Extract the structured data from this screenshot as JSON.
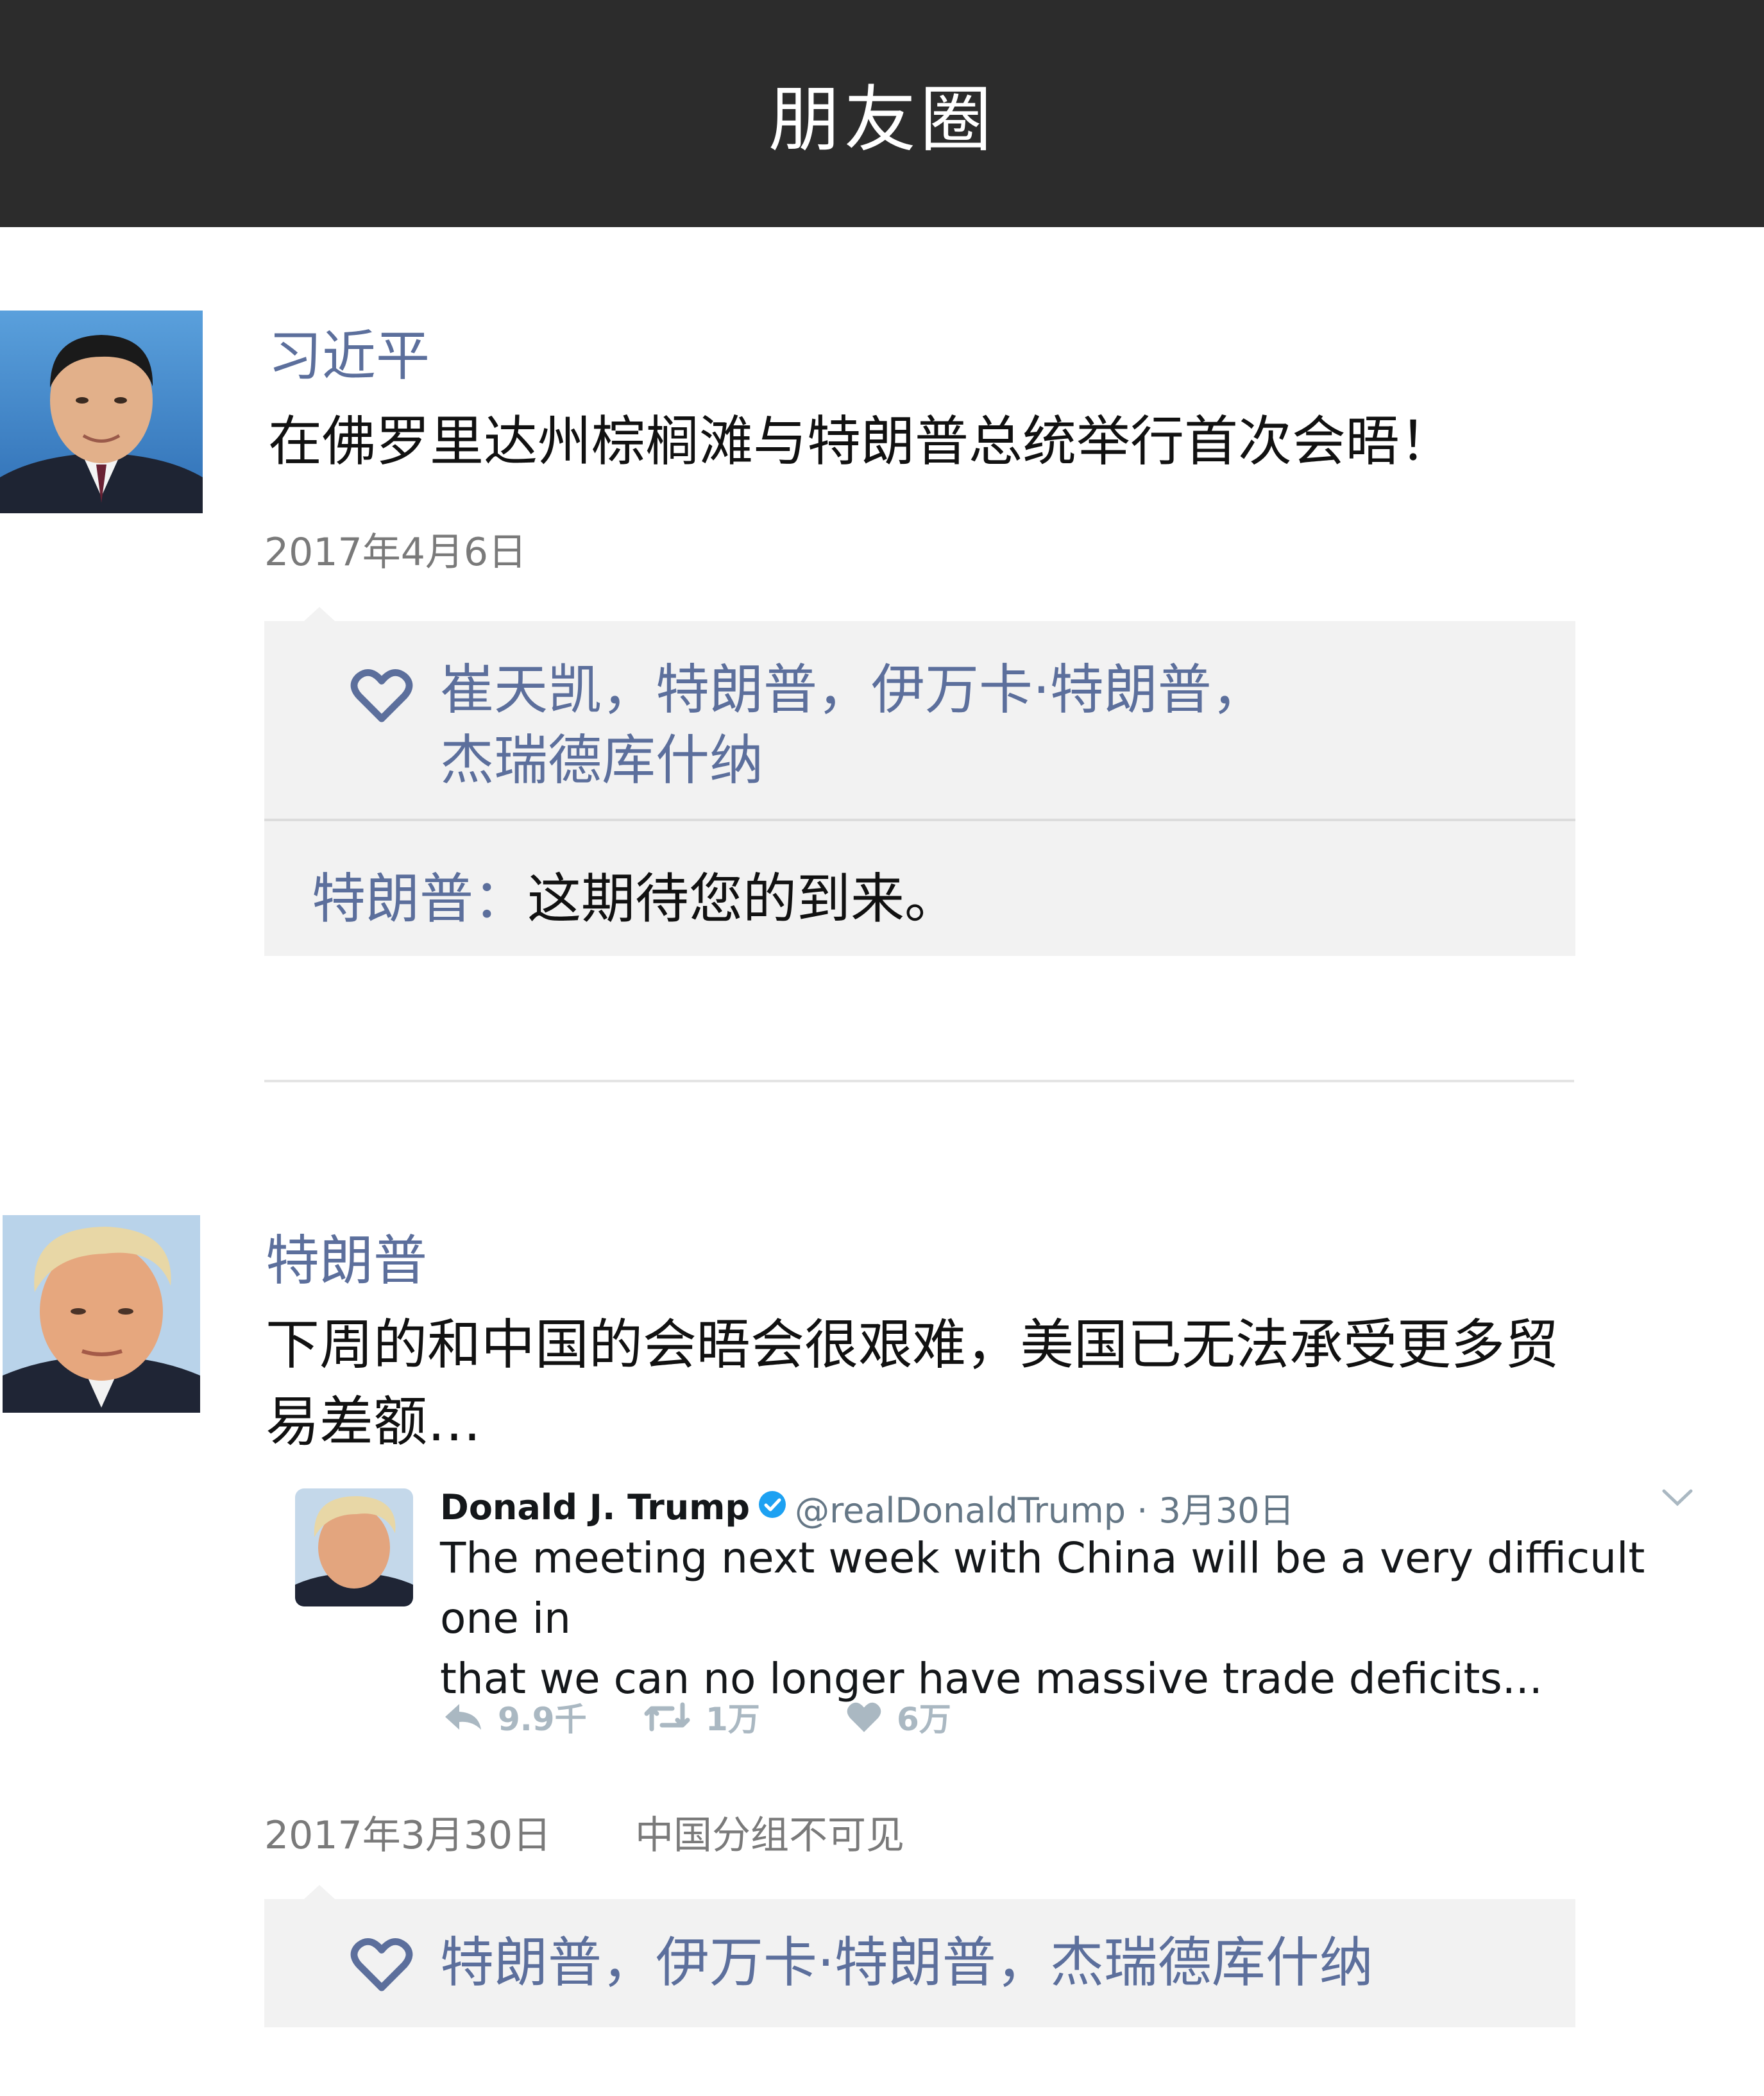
{
  "header": {
    "title": "朋友圈"
  },
  "posts": [
    {
      "author": "习近平",
      "text": "在佛罗里达州棕榈滩与特朗普总统举行首次会晤！",
      "date": "2017年4月6日",
      "likes_line1": "崔天凯，特朗普，伊万卡·特朗普，",
      "likes_line2": "杰瑞德库什纳",
      "comment": {
        "author": "特朗普：",
        "text": "这期待您的到来。"
      }
    },
    {
      "author": "特朗普",
      "text_line1": "下周的和中国的会晤会很艰难，美国已无法承受更多贸",
      "text_line2": "易差额…",
      "date": "2017年3月30日",
      "visibility": "中国分组不可见",
      "likes": "特朗普，伊万卡·特朗普，杰瑞德库什纳",
      "tweet": {
        "name": "Donald J. Trump",
        "handle": "@realDonaldTrump · 3月30日",
        "text_line1": "The meeting next week with China will be a very difficult one in",
        "text_line2": "that we can no longer have massive trade deficits...",
        "replies": "9.9千",
        "retweets": "1万",
        "likes": "6万"
      }
    }
  ],
  "colors": {
    "header_bg": "#2c2c2c",
    "name_blue": "#5c6f9c",
    "likes_bg": "#f2f2f2",
    "twitter_blue": "#1da1f2"
  },
  "icons": [
    "heart-icon",
    "verified-icon",
    "chevron-down-icon",
    "reply-icon",
    "retweet-icon",
    "like-icon"
  ]
}
